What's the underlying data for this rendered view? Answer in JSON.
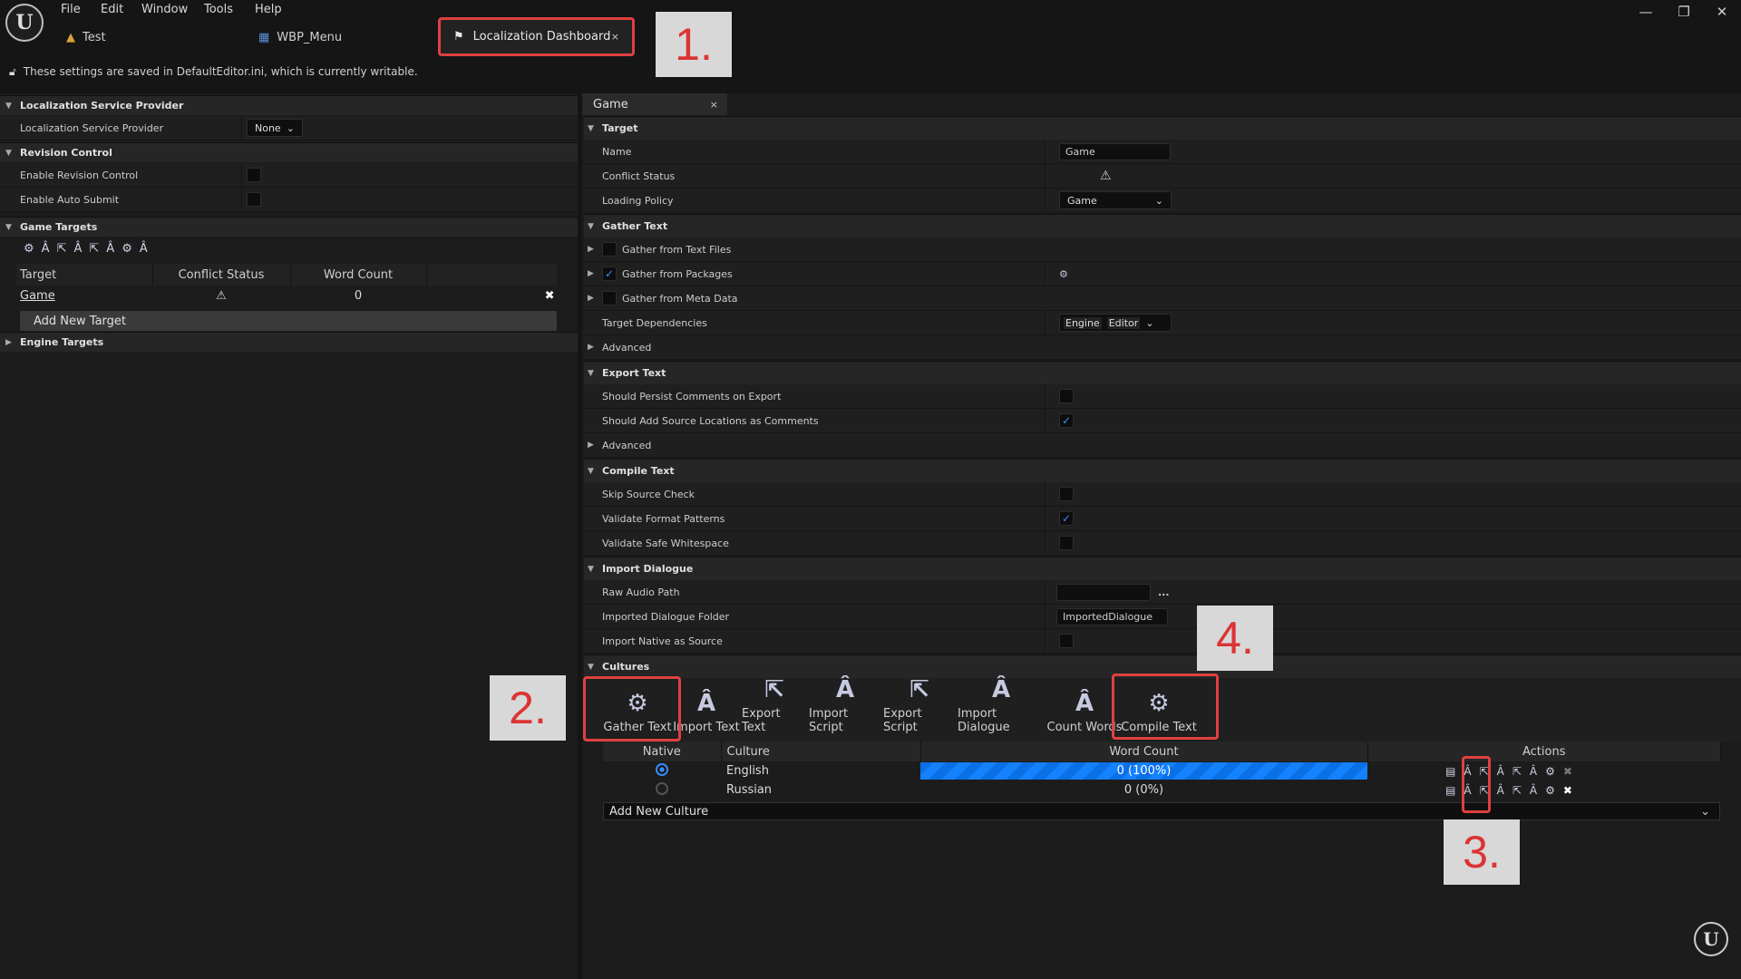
{
  "menu": [
    "File",
    "Edit",
    "Window",
    "Tools",
    "Help"
  ],
  "doc_tabs": [
    {
      "label": "Test"
    },
    {
      "label": "WBP_Menu"
    }
  ],
  "active_tab": {
    "label": "Localization Dashboard",
    "close": "×"
  },
  "callouts": [
    "1.",
    "2.",
    "3.",
    "4."
  ],
  "notice": "These settings are saved in DefaultEditor.ini, which is currently writable.",
  "window_controls": [
    "—",
    "❐",
    "✕"
  ],
  "left": {
    "sec_lsp": "Localization Service Provider",
    "lsp_label": "Localization Service Provider",
    "lsp_value": "None",
    "sec_rc": "Revision Control",
    "enable_rc": "Enable Revision Control",
    "enable_auto": "Enable Auto Submit",
    "sec_game_targets": "Game Targets",
    "gt_headers": [
      "Target",
      "Conflict Status",
      "Word Count"
    ],
    "gt_row": {
      "target": "Game",
      "word_count": "0"
    },
    "add_target": "Add New Target",
    "sec_engine_targets": "Engine Targets"
  },
  "right": {
    "tab_label": "Game",
    "tab_close": "×",
    "sec_target": "Target",
    "name_label": "Name",
    "name_value": "Game",
    "conflict_label": "Conflict Status",
    "loading_label": "Loading Policy",
    "loading_value": "Game",
    "sec_gather": "Gather Text",
    "gather_text_files": "Gather from Text Files",
    "gather_packages": "Gather from Packages",
    "gather_meta": "Gather from Meta Data",
    "target_deps": "Target Dependencies",
    "deps_engine": "Engine",
    "deps_editor": "Editor",
    "advanced": "Advanced",
    "sec_export": "Export Text",
    "persist_comments": "Should Persist Comments on Export",
    "add_source_locs": "Should Add Source Locations as Comments",
    "sec_compile": "Compile Text",
    "skip_source": "Skip Source Check",
    "validate_format": "Validate Format Patterns",
    "validate_ws": "Validate Safe Whitespace",
    "sec_import_dialogue": "Import Dialogue",
    "raw_audio": "Raw Audio Path",
    "raw_audio_more": "...",
    "imported_folder": "Imported Dialogue Folder",
    "imported_folder_value": "ImportedDialogue",
    "import_native": "Import Native as Source",
    "sec_cultures": "Cultures"
  },
  "toolbar": [
    {
      "label": "Gather Text",
      "icon": "gather-icon"
    },
    {
      "label": "Import Text",
      "icon": "import-text-icon"
    },
    {
      "label": "Export Text",
      "icon": "export-text-icon"
    },
    {
      "label": "Import Script",
      "icon": "import-script-icon"
    },
    {
      "label": "Export Script",
      "icon": "export-script-icon"
    },
    {
      "label": "Import Dialogue",
      "icon": "import-dialogue-icon"
    },
    {
      "label": "Count Words",
      "icon": "count-words-icon"
    },
    {
      "label": "Compile Text",
      "icon": "compile-icon"
    }
  ],
  "cultures": {
    "headers": [
      "Native",
      "Culture",
      "Word Count",
      "Actions"
    ],
    "rows": [
      {
        "culture": "English",
        "word_count": "0 (100%)",
        "progress": 1.0,
        "native": true
      },
      {
        "culture": "Russian",
        "word_count": "0 (0%)",
        "progress": 0.0,
        "native": false
      }
    ],
    "add_culture": "Add New Culture"
  },
  "colors": {
    "accent": "#3a8bff",
    "annotation": "#e04040",
    "background": "#151515"
  }
}
